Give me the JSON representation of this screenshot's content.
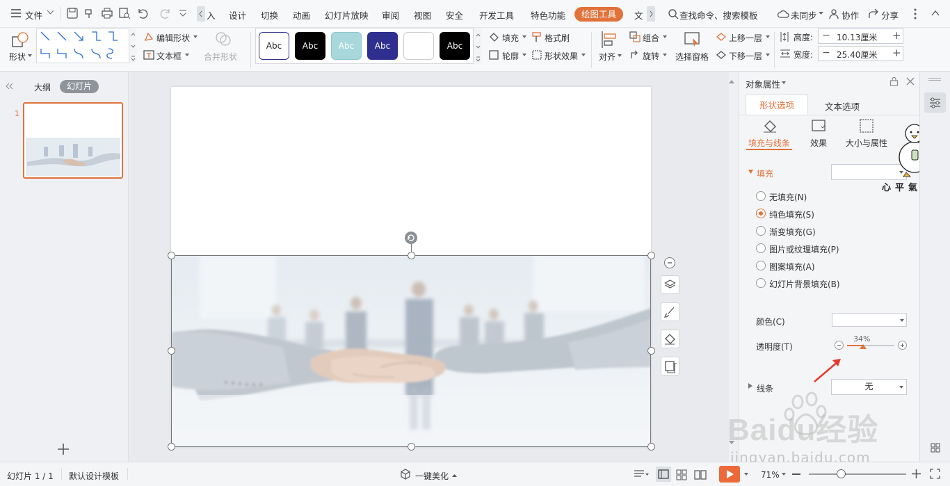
{
  "menubar": {
    "file": "文件",
    "tabs": [
      "入",
      "设计",
      "切换",
      "动画",
      "幻灯片放映",
      "审阅",
      "视图",
      "安全",
      "开发工具",
      "特色功能",
      "绘图工具",
      "文"
    ],
    "search": "查找命令、搜索模板",
    "sync": "未同步",
    "collab": "协作",
    "share": "分享"
  },
  "ribbon": {
    "shape": "形状",
    "edit_shape": "编辑形状",
    "textbox": "文本框",
    "merge_shape": "合并形状",
    "styles": [
      "Abc",
      "Abc",
      "Abc",
      "Abc",
      "",
      "Abc"
    ],
    "fill": "填充",
    "format_painter": "格式刷",
    "outline": "轮廓",
    "shape_effect": "形状效果",
    "align": "对齐",
    "group": "组合",
    "rotate": "旋转",
    "selection_pane": "选择窗格",
    "bring_forward": "上移一层",
    "send_backward": "下移一层",
    "height_label": "高度:",
    "height_value": "10.13厘米",
    "width_label": "宽度:",
    "width_value": "25.40厘米"
  },
  "leftpane": {
    "outline_tab": "大纲",
    "slides_tab": "幻灯片",
    "slide_number": "1"
  },
  "rightpane": {
    "title": "对象属性",
    "tab_shape": "形状选项",
    "tab_text": "文本选项",
    "sub_fill_line": "填充与线条",
    "sub_effect": "效果",
    "sub_size": "大小与属性",
    "fill_section": "填充",
    "fill_options": [
      "无填充(N)",
      "纯色填充(S)",
      "渐变填充(G)",
      "图片或纹理填充(P)",
      "图案填充(A)",
      "幻灯片背景填充(B)"
    ],
    "selected_fill_index": 1,
    "color_label": "颜色(C)",
    "transparency_label": "透明度(T)",
    "transparency_value": "34%",
    "line_section": "线条",
    "line_value": "无"
  },
  "watermark": {
    "duck_caption": "心平氣和鴨",
    "baidu": "Baidu经验",
    "url": "jingyan.baidu.com"
  },
  "status": {
    "slide_info": "幻灯片 1 / 1",
    "template": "默认设计模板",
    "beautify": "一键美化",
    "zoom": "71%"
  },
  "colors": {
    "accent": "#e0723a",
    "style_black": "#000000",
    "style_teal": "#a8d8dc",
    "style_navy": "#2f2f8f"
  }
}
